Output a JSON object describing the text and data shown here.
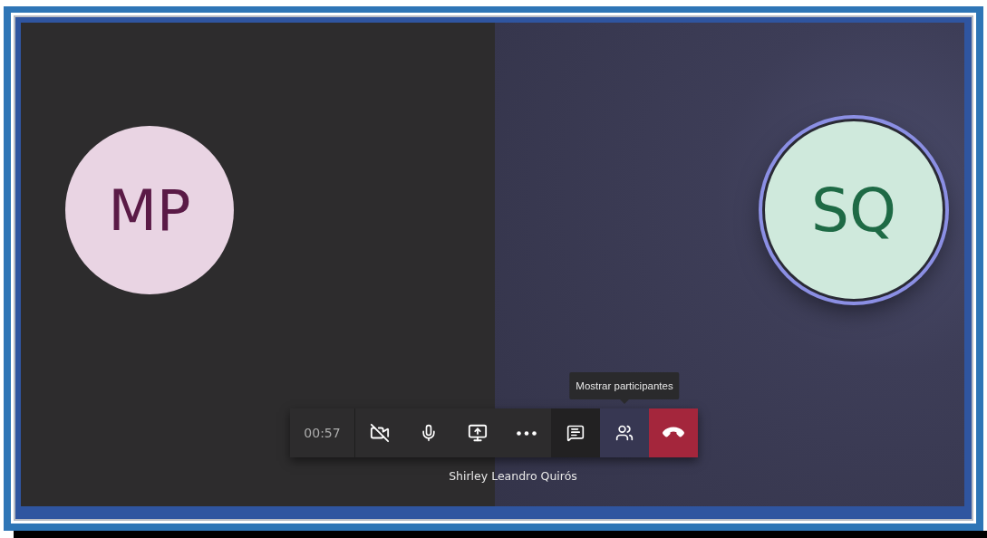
{
  "participants": [
    {
      "initials": "MP",
      "color": "#e9d4e3",
      "speaking": false
    },
    {
      "initials": "SQ",
      "color": "#cfe9dc",
      "speaking": true
    }
  ],
  "toolbar": {
    "timer": "00:57",
    "buttons": [
      {
        "kind": "video",
        "selected": false
      },
      {
        "kind": "mic",
        "selected": false
      },
      {
        "kind": "share",
        "selected": false
      },
      {
        "kind": "more",
        "selected": false
      },
      {
        "kind": "chat",
        "selected": false
      },
      {
        "kind": "participants",
        "selected": true
      },
      {
        "kind": "hangup",
        "selected": false
      }
    ]
  },
  "tooltip": "Mostrar participantes",
  "caller_name": "Shirley Leandro Quirós"
}
